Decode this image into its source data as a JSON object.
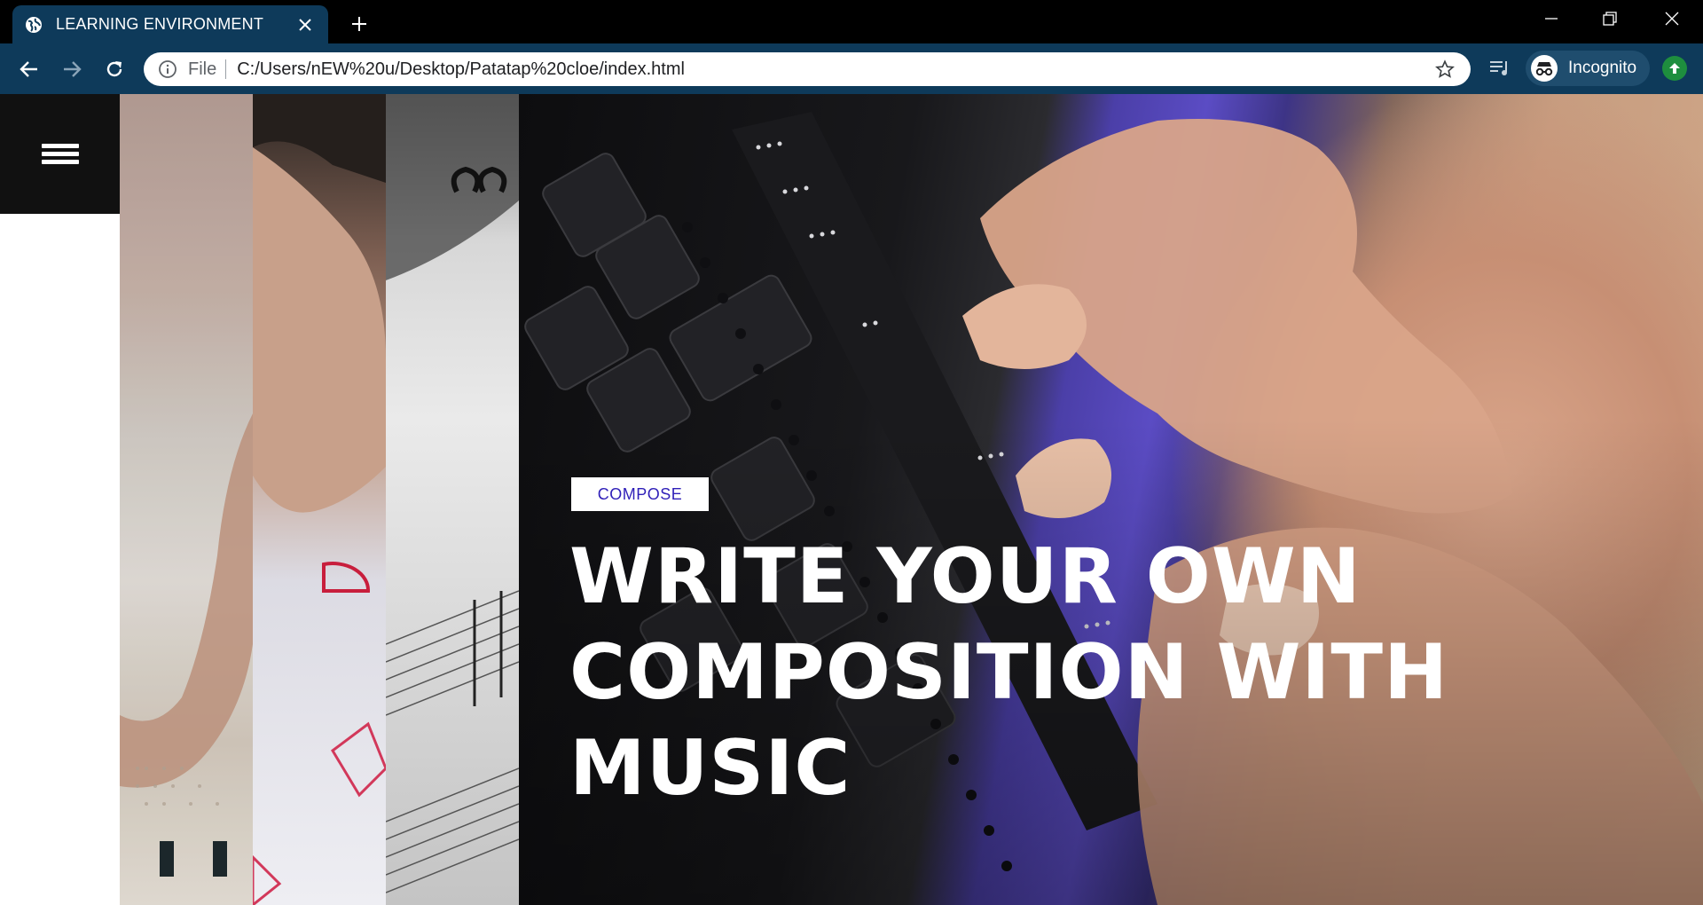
{
  "browser": {
    "tab": {
      "title": "LEARNING ENVIRONMENT",
      "favicon": "globe-icon"
    },
    "address": {
      "scheme": "File",
      "url": "C:/Users/nEW%20u/Desktop/Patatap%20cloe/index.html"
    },
    "profile": {
      "label": "Incognito"
    },
    "colors": {
      "frame": "#000000",
      "toolbar": "#0e3a5a",
      "update": "#1e8e3e"
    }
  },
  "page": {
    "menu": {
      "icon": "hamburger-menu-icon"
    },
    "hero": {
      "badge": "COMPOSE",
      "headline": [
        "WRITE YOUR OWN",
        "COMPOSITION WITH",
        "MUSIC"
      ],
      "colors": {
        "badge_text": "#2f1fb8",
        "headline": "#ffffff"
      }
    }
  }
}
